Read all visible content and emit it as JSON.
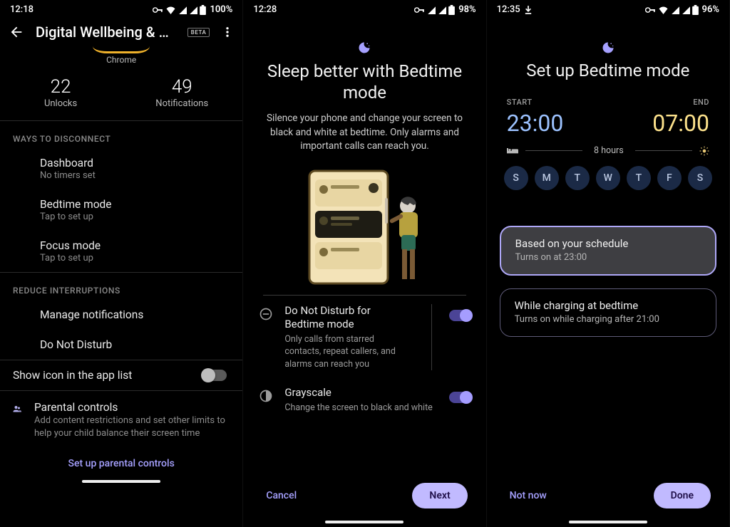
{
  "s1": {
    "status": {
      "time": "12:18",
      "battery": "100%"
    },
    "title": "Digital Wellbeing & pa…",
    "beta": "BETA",
    "app_label": "Chrome",
    "stats": {
      "unlocks_val": "22",
      "unlocks_lbl": "Unlocks",
      "notif_val": "49",
      "notif_lbl": "Notifications"
    },
    "section_disconnect": "WAYS TO DISCONNECT",
    "dashboard": {
      "title": "Dashboard",
      "sub": "No timers set"
    },
    "bedtime": {
      "title": "Bedtime mode",
      "sub": "Tap to set up"
    },
    "focus": {
      "title": "Focus mode",
      "sub": "Tap to set up"
    },
    "section_reduce": "REDUCE INTERRUPTIONS",
    "manage_notif": "Manage notifications",
    "dnd": "Do Not Disturb",
    "show_icon": "Show icon in the app list",
    "parental": {
      "title": "Parental controls",
      "sub": "Add content restrictions and set other limits to help your child balance their screen time",
      "link": "Set up parental controls"
    }
  },
  "s2": {
    "status": {
      "time": "12:28",
      "battery": "98%"
    },
    "heading": "Sleep better with Bedtime mode",
    "body": "Silence your phone and change your screen to black and white at bedtime. Only alarms and important calls can reach you.",
    "dnd": {
      "title": "Do Not Disturb for Bedtime mode",
      "sub": "Only calls from starred contacts, repeat callers, and alarms can reach you",
      "on": true
    },
    "gray": {
      "title": "Grayscale",
      "sub": "Change the screen to black and white",
      "on": true
    },
    "cancel": "Cancel",
    "next": "Next"
  },
  "s3": {
    "status": {
      "time": "12:35",
      "battery": "96%"
    },
    "heading": "Set up Bedtime mode",
    "start_lbl": "START",
    "start_time": "23:00",
    "end_lbl": "END",
    "end_time": "07:00",
    "duration": "8 hours",
    "days": [
      "S",
      "M",
      "T",
      "W",
      "T",
      "F",
      "S"
    ],
    "opt1": {
      "title": "Based on your schedule",
      "sub": "Turns on at 23:00"
    },
    "opt2": {
      "title": "While charging at bedtime",
      "sub": "Turns on while charging after 21:00"
    },
    "not_now": "Not now",
    "done": "Done"
  }
}
